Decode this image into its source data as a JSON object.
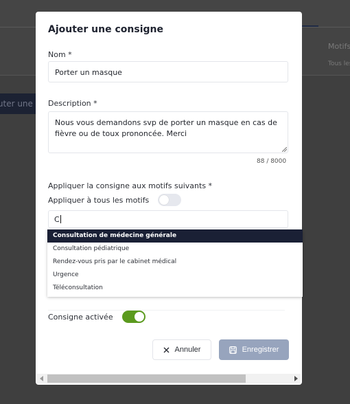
{
  "background": {
    "tab_label": "Motifs",
    "sub_label": "Tous les",
    "button_label": "Ajouter une consigne"
  },
  "modal": {
    "title": "Ajouter une consigne",
    "name": {
      "label": "Nom *",
      "value": "Porter un masque"
    },
    "description": {
      "label": "Description *",
      "value": "Nous vous demandons svp de porter un masque en cas de fièvre ou de toux prononcée. Merci",
      "counter": "88 / 8000"
    },
    "motifs": {
      "label": "Appliquer la consigne aux motifs suivants *",
      "apply_all_label": "Appliquer à tous les motifs",
      "apply_all_on": false,
      "search_value": "C",
      "options": [
        "Consultation de médecine générale",
        "Consultation pédiatrique",
        "Rendez-vous pris par le cabinet médical",
        "Urgence",
        "Téléconsultation"
      ],
      "highlighted_index": 0
    },
    "active": {
      "label": "Consigne activée",
      "on": true
    },
    "buttons": {
      "cancel": "Annuler",
      "save": "Enregistrer"
    }
  },
  "colors": {
    "accent_dark": "#1a2035",
    "toggle_on": "#5b9a1e",
    "save_disabled": "#97a4bd"
  },
  "icons": {
    "cancel": "close-icon",
    "save": "save-icon"
  }
}
